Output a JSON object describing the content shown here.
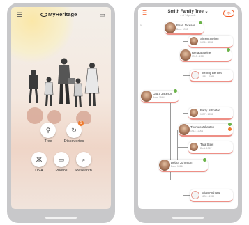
{
  "home": {
    "logo_text": "MyHeritage",
    "menu_icon": "hamburger-icon",
    "inbox_icon": "inbox-icon",
    "features": [
      {
        "label": "Tree",
        "icon": "tree-icon",
        "glyph": "⚲"
      },
      {
        "label": "Discoveries",
        "icon": "discoveries-icon",
        "glyph": "↻",
        "badge": "1"
      },
      {
        "label": "DNA",
        "icon": "dna-icon",
        "glyph": "Ж"
      },
      {
        "label": "Photos",
        "icon": "photos-icon",
        "glyph": "▭"
      },
      {
        "label": "Research",
        "icon": "research-icon",
        "glyph": "⌕"
      }
    ]
  },
  "tree": {
    "title": "Smith Family Tree ⌄",
    "subtitle": "4 of 74 people",
    "toggle_label": "◁▷",
    "people": [
      {
        "name": "Brian Jaceson",
        "dates": "Born: 1955",
        "style": "partial"
      },
      {
        "name": "Simon Steiner",
        "dates": "1876 - 1958",
        "style": "photo"
      },
      {
        "name": "Renata Steiner",
        "dates": "1910 - 1985",
        "style": "photo"
      },
      {
        "name": "Tommy Bennett",
        "dates": "1881 - 1953",
        "style": "silhouette"
      },
      {
        "name": "Laura Jaceson",
        "dates": "Born: 1964",
        "style": "photo"
      },
      {
        "name": "Barry Johnston",
        "dates": "1897 - 1958",
        "style": "photo"
      },
      {
        "name": "Thomas Johnston",
        "dates": "1914 - 2001",
        "style": "photo"
      },
      {
        "name": "Tara Steel",
        "dates": "Died: 1967",
        "style": "photo"
      },
      {
        "name": "Debra Johnston",
        "dates": "Born: 1986",
        "style": "photo"
      },
      {
        "name": "Brian Anthony",
        "dates": "1894 - 1959",
        "style": "silhouette"
      }
    ]
  },
  "colors": {
    "accent": "#f0561f",
    "card_border": "#ee8f86",
    "green_dot": "#6bb349",
    "orange_dot": "#f07a2c"
  }
}
